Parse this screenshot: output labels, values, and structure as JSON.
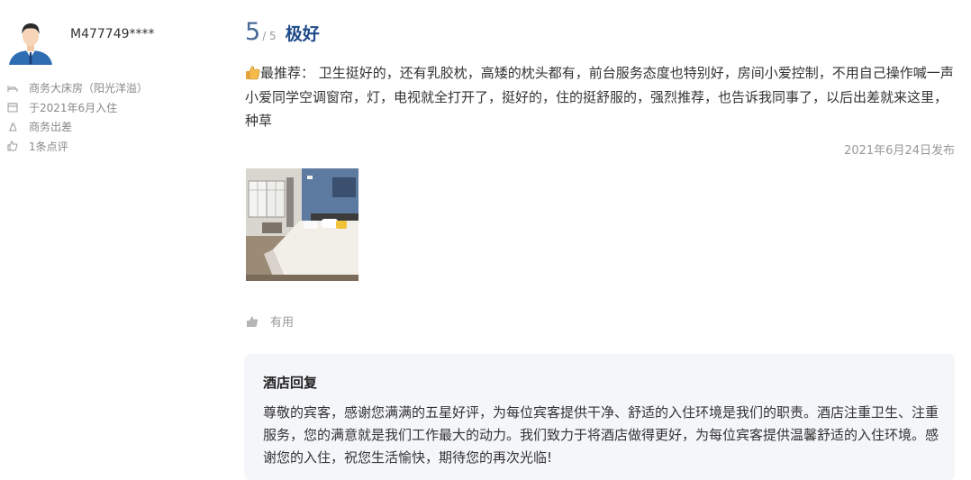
{
  "user": {
    "name": "M477749****",
    "room_type": "商务大床房（阳光洋溢）",
    "stay_date": "于2021年6月入住",
    "trip_type": "商务出差",
    "review_count": "1条点评"
  },
  "rating": {
    "score": "5",
    "total": "/ 5",
    "label": "极好"
  },
  "review": {
    "text": "最推荐： 卫生挺好的，还有乳胶枕，高矮的枕头都有，前台服务态度也特别好，房间小爱控制，不用自己操作喊一声小爱同学空调窗帘，灯，电视就全打开了，挺好的，住的挺舒服的，强烈推荐，也告诉我同事了，以后出差就来这里，种草",
    "date": "2021年6月24日发布"
  },
  "actions": {
    "useful_label": "有用"
  },
  "hotel_reply": {
    "title": "酒店回复",
    "text": "尊敬的宾客，感谢您满满的五星好评，为每位宾客提供干净、舒适的入住环境是我们的职责。酒店注重卫生、注重服务，您的满意就是我们工作最大的动力。我们致力于将酒店做得更好，为每位宾客提供温馨舒适的入住环境。感谢您的入住，祝您生活愉快，期待您的再次光临!"
  },
  "colors": {
    "score": "#4a6a96",
    "label": "#1f4a8a",
    "reply_bg": "#f4f6f9"
  },
  "icons": [
    "avatar",
    "bed-icon",
    "calendar-icon",
    "trip-icon",
    "review-count-icon",
    "thumbs-up-icon",
    "like-icon"
  ]
}
